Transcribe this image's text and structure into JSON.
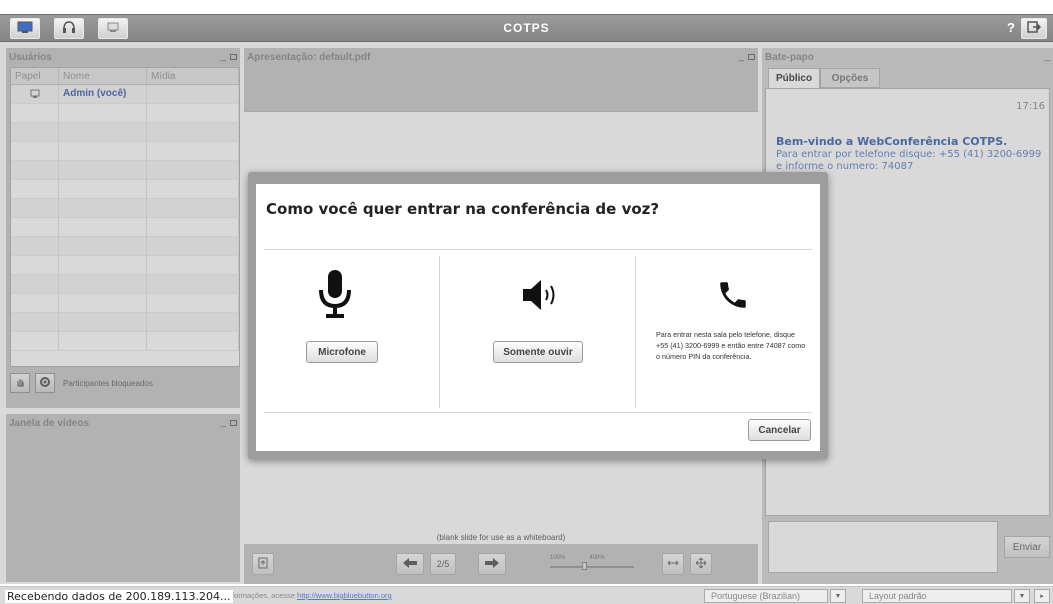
{
  "app": {
    "title": "COTPS",
    "help": "?"
  },
  "users": {
    "title": "Usuários",
    "columns": [
      "Papel",
      "Nome",
      "Mídia"
    ],
    "rows": [
      {
        "name": "Admin (você)"
      }
    ],
    "locked_label": "Participantes bloqueados"
  },
  "video": {
    "title": "Janela de vídeos"
  },
  "presentation": {
    "title": "Apresentação: default.pdf",
    "slide_caption": "(blank slide for use as a whiteboard)",
    "page_indicator": "2/5",
    "zoom_min": "100%",
    "zoom_max": "400%"
  },
  "chat": {
    "title": "Bate-papo",
    "tabs": [
      "Público",
      "Opções"
    ],
    "time": "17:16",
    "welcome": "Bem-vindo a WebConferência COTPS.",
    "phone_info": "Para entrar por telefone disque: +55 (41) 3200-6999 e informe o numero: 74087",
    "send_label": "Enviar"
  },
  "dialog": {
    "title": "Como você quer entrar na conferência de voz?",
    "microphone_label": "Microfone",
    "listen_label": "Somente ouvir",
    "phone_text": "Para entrar nesta sala pelo telefone, disque +55 (41) 3200-6999 e então entre 74087 como o número PIN da conferência.",
    "cancel_label": "Cancelar"
  },
  "statusbar": {
    "status": "Recebendo dados de 200.189.113.204...",
    "info_prefix": "formações, acesse ",
    "info_link": "http://www.bigbluebutton.org",
    "language": "Portuguese (Brazilian)",
    "layout": "Layout padrão"
  }
}
